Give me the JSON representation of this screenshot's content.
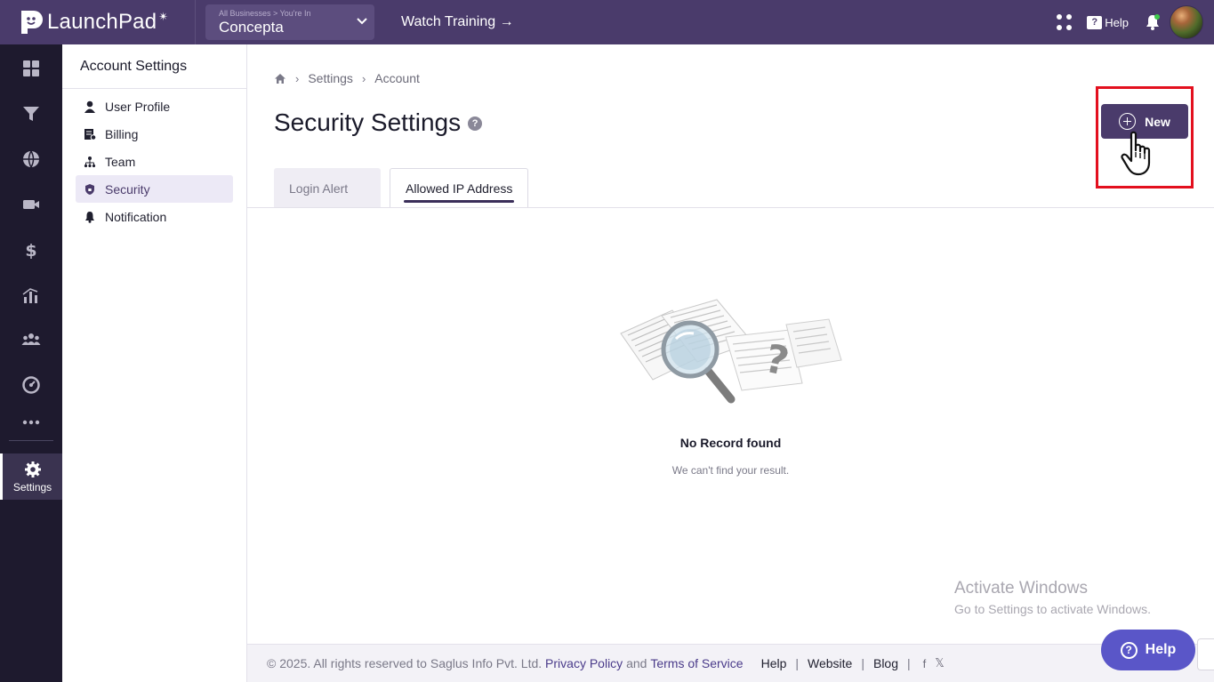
{
  "app": {
    "name": "LaunchPad",
    "business_crumb": "All Businesses > You're In",
    "business_name": "Concepta",
    "watch_training": "Watch Training →",
    "help_label": "Help"
  },
  "rail": {
    "items": [
      "dashboard-icon",
      "funnel-icon",
      "globe-icon",
      "video-icon",
      "dollar-icon",
      "analytics-icon",
      "people-icon",
      "gauge-icon",
      "more-icon"
    ],
    "settings_label": "Settings"
  },
  "subnav": {
    "title": "Account Settings",
    "items": [
      {
        "label": "User Profile",
        "icon": "user-icon"
      },
      {
        "label": "Billing",
        "icon": "billing-icon"
      },
      {
        "label": "Team",
        "icon": "team-icon"
      },
      {
        "label": "Security",
        "icon": "shield-icon",
        "active": true
      },
      {
        "label": "Notification",
        "icon": "bell-icon"
      }
    ]
  },
  "breadcrumb": [
    "Settings",
    "Account"
  ],
  "page": {
    "title": "Security Settings",
    "new_button": "New",
    "tabs": [
      {
        "label": "Login Alert",
        "active": false
      },
      {
        "label": "Allowed IP Address",
        "active": true
      }
    ],
    "empty_title": "No Record found",
    "empty_sub": "We can't find your result."
  },
  "watermark": {
    "line1": "Activate Windows",
    "line2": "Go to Settings to activate Windows."
  },
  "footer": {
    "copyright": "©  2025. All rights reserved to Saglus Info Pvt. Ltd.",
    "privacy": "Privacy Policy",
    "and": "and",
    "terms": "Terms of Service",
    "links": [
      "Help",
      "Website",
      "Blog"
    ]
  },
  "help_float": "Help",
  "colors": {
    "topbar": "#4a3b6b",
    "rail": "#1e1a2e",
    "accent": "#4a3b6b",
    "highlight_outline": "#e3101e",
    "help_float": "#5a56c8"
  }
}
